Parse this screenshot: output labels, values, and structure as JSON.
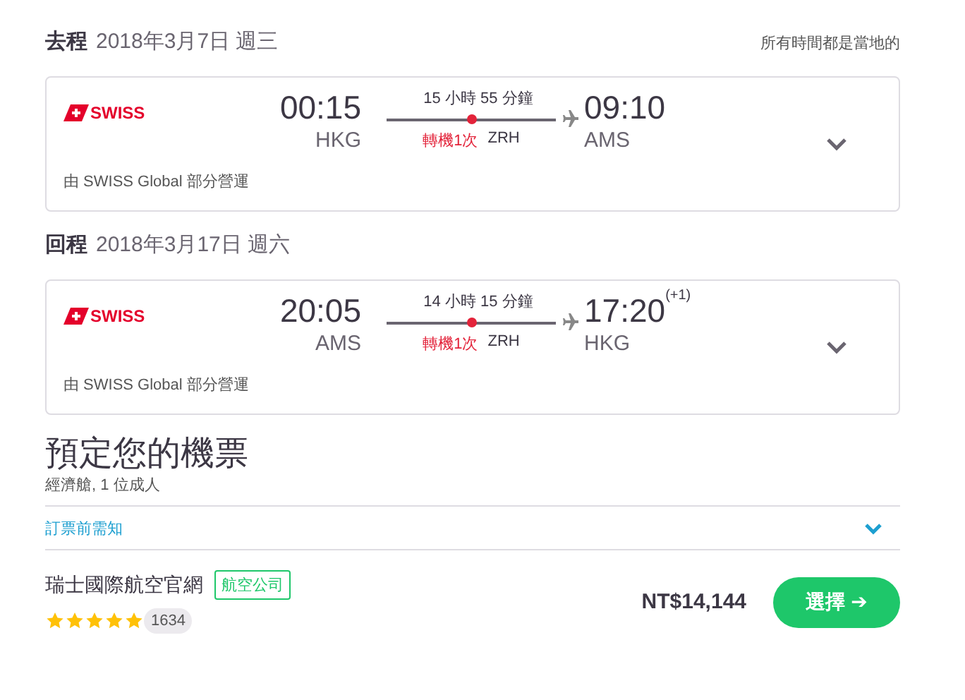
{
  "legs": [
    {
      "label": "去程",
      "date": "2018年3月7日 週三",
      "note": "所有時間都是當地的",
      "airline_logo": "SWISS",
      "dep_time": "00:15",
      "dep_airport": "HKG",
      "duration": "15 小時 55 分鐘",
      "stops": "轉機1次",
      "via": "ZRH",
      "arr_time": "09:10",
      "arr_airport": "AMS",
      "operated_by": "由 SWISS Global 部分營運"
    },
    {
      "label": "回程",
      "date": "2018年3月17日 週六",
      "airline_logo": "SWISS",
      "dep_time": "20:05",
      "dep_airport": "AMS",
      "duration": "14 小時 15 分鐘",
      "stops": "轉機1次",
      "via": "ZRH",
      "arr_time": "17:20",
      "arr_day_offset": "(+1)",
      "arr_airport": "HKG",
      "operated_by": "由 SWISS Global 部分營運"
    }
  ],
  "booking": {
    "title": "預定您的機票",
    "subtitle": "經濟艙, 1 位成人",
    "notice": "訂票前需知",
    "notice_expanded": false
  },
  "offers": [
    {
      "provider": "瑞士國際航空官網",
      "tag": "航空公司",
      "stars": 5,
      "reviews": "1634",
      "price": "NT$14,144",
      "button": "選擇 ➔"
    }
  ]
}
